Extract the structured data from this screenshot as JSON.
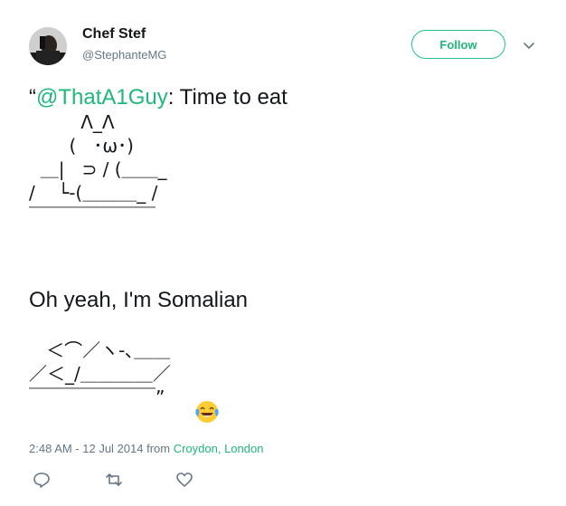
{
  "author": {
    "name": "Chef Stef",
    "handle": "@StephanteMG",
    "follow_label": "Follow"
  },
  "tweet": {
    "open_quote": "“",
    "mention": "@ThatA1Guy",
    "text_after_mention": ": Time to eat",
    "art1": "         Λ_Λ\n       (   ･ω･)\n  ＿|   ⊃ / (＿＿_\n/    └-(＿＿＿_ /\n￣￣￣￣￣￣￣",
    "line2": "Oh yeah, I'm Somalian",
    "art2": "   ＜⌒／ヽ-､＿＿\n／＜_/＿＿＿＿／\n￣￣￣￣￣￣￣”",
    "emoji": "face-with-tears-of-joy"
  },
  "meta": {
    "time_date": "2:48 AM - 12 Jul 2014 from ",
    "location": "Croydon, London"
  },
  "actions": {
    "reply_icon": "reply-icon",
    "retweet_icon": "retweet-icon",
    "like_icon": "heart-icon"
  }
}
